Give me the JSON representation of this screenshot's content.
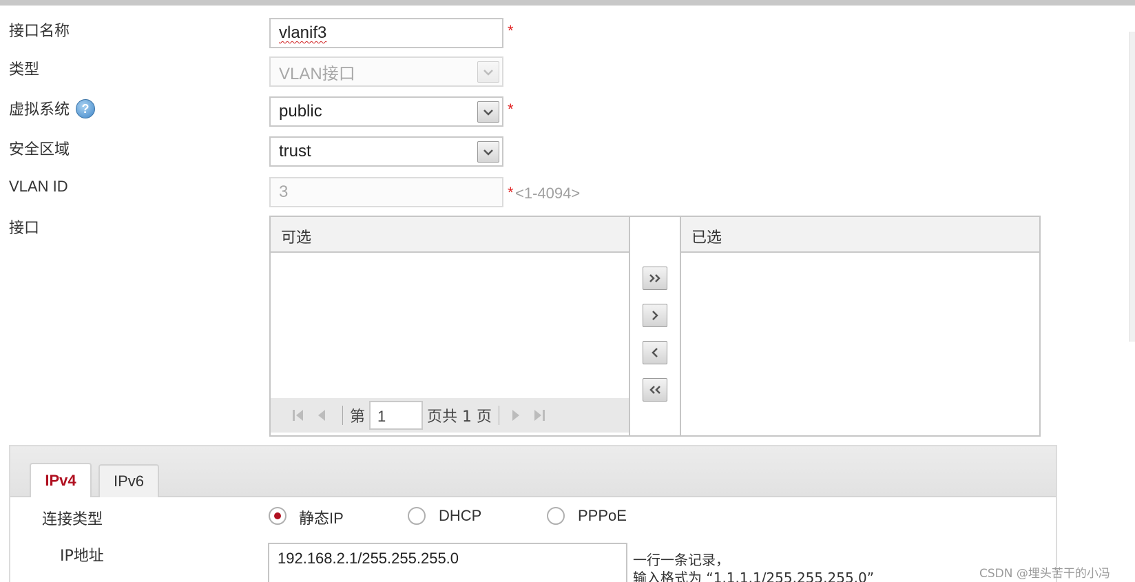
{
  "form": {
    "interface_name": {
      "label": "接口名称",
      "value": "vlanif3",
      "required": "*"
    },
    "type": {
      "label": "类型",
      "value": "VLAN接口"
    },
    "virtual_system": {
      "label": "虚拟系统",
      "value": "public",
      "required": "*",
      "help_icon": "question-icon"
    },
    "security_zone": {
      "label": "安全区域",
      "value": "trust"
    },
    "vlan_id": {
      "label": "VLAN ID",
      "value": "3",
      "required": "*",
      "range_hint": "<1-4094>"
    },
    "interface": {
      "label": "接口"
    }
  },
  "dual_list": {
    "available_header": "可选",
    "selected_header": "已选",
    "buttons": {
      "add_all": "double-chevron-right-icon",
      "add": "chevron-right-icon",
      "remove": "chevron-left-icon",
      "remove_all": "double-chevron-left-icon"
    },
    "pager": {
      "prefix": "第",
      "page": "1",
      "suffix": "页共 1 页"
    }
  },
  "tabs": [
    {
      "label": "IPv4",
      "active": true
    },
    {
      "label": "IPv6",
      "active": false
    }
  ],
  "ipv4": {
    "connection_type_label": "连接类型",
    "options": [
      {
        "label": "静态IP",
        "checked": true
      },
      {
        "label": "DHCP",
        "checked": false
      },
      {
        "label": "PPPoE",
        "checked": false
      }
    ],
    "ip_label": "IP地址",
    "ip_value": "192.168.2.1/255.255.255.0",
    "hint_line1": "一行一条记录，",
    "hint_line2": "输入格式为 “1.1.1.1/255.255.255.0”"
  },
  "watermark": "CSDN @埋头苦干的小冯",
  "colors": {
    "accent": "#b01020",
    "required": "#e02020",
    "border": "#c6c6c6"
  }
}
